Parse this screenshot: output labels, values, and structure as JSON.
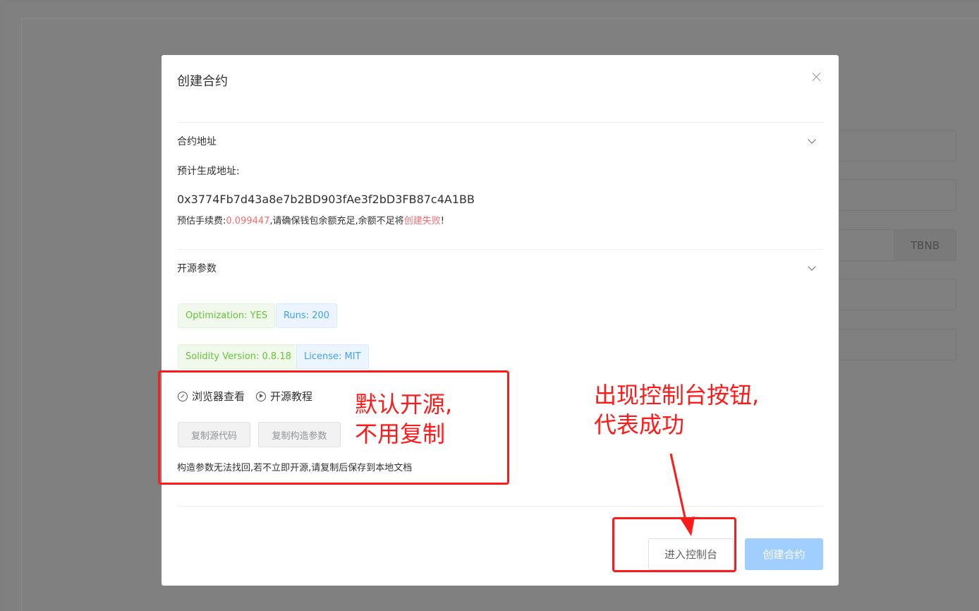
{
  "background": {
    "addon_label": "TBNB"
  },
  "modal": {
    "title": "创建合约",
    "contract_section": {
      "heading": "合约地址",
      "predicted_label": "预计生成地址:",
      "address": "0x3774Fb7d43a8e7b2BD903fAe3f2bD3FB87c4A1BB",
      "fee_prefix": "预估手续费:",
      "fee_value": "0.099447",
      "fee_middle": ",请确保钱包余额充足,余额不足将",
      "fee_fail": "创建失败",
      "fee_suffix": "!"
    },
    "opensource_section": {
      "heading": "开源参数",
      "tags": {
        "optimization": "Optimization: YES",
        "runs": "Runs: 200",
        "solidity": "Solidity Version: 0.8.18",
        "license": "License: MIT"
      },
      "links": {
        "browser": "浏览器查看",
        "tutorial": "开源教程"
      },
      "buttons": {
        "copy_source": "复制源代码",
        "copy_params": "复制构造参数"
      },
      "notice": "构造参数无法找回,若不立即开源,请复制后保存到本地文档"
    },
    "footer": {
      "console_button": "进入控制台",
      "create_button": "创建合约"
    }
  },
  "annotations": {
    "left_note_line1": "默认开源,",
    "left_note_line2": "不用复制",
    "right_note_line1": "出现控制台按钮,",
    "right_note_line2": "代表成功",
    "color": "#ff1a1a"
  }
}
